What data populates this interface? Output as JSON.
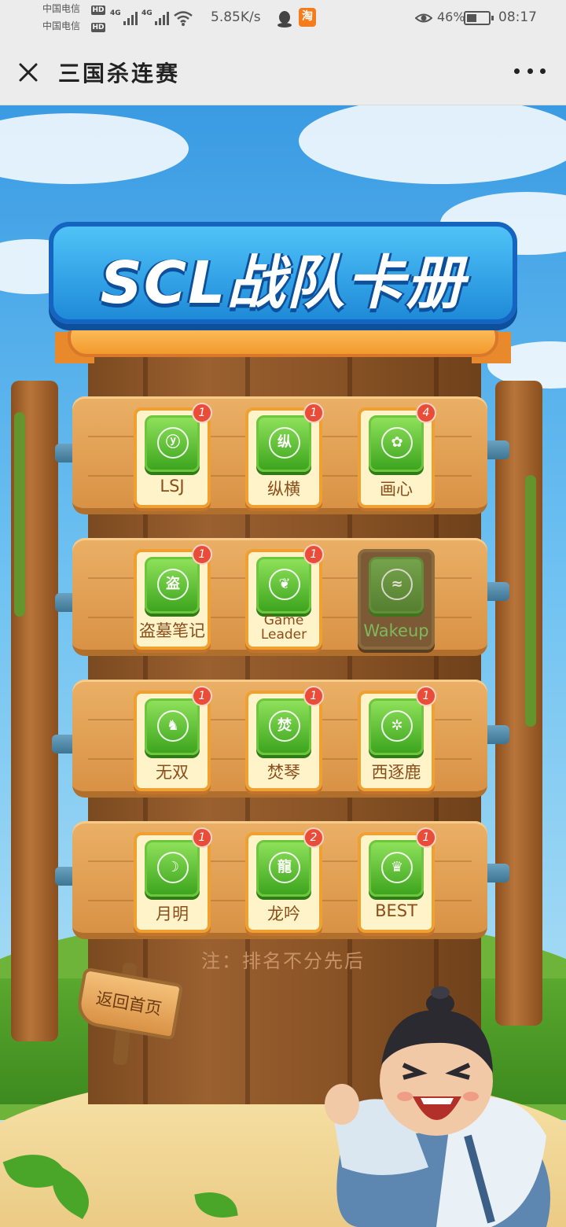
{
  "status_bar": {
    "carrier_1": "中国电信",
    "carrier_2": "中国电信",
    "hd_label": "HD",
    "net_label": "4G",
    "net_speed": "5.85K/s",
    "taobao": "淘",
    "battery_pct": "46%",
    "battery_level": 0.46,
    "time": "08:17"
  },
  "title_bar": {
    "title": "三国杀连赛"
  },
  "banner": {
    "title": "SCL战队卡册"
  },
  "teams": [
    {
      "name": "LSJ",
      "badge": "1",
      "active": true,
      "glyph": "ⓨ"
    },
    {
      "name": "纵横",
      "badge": "1",
      "active": true,
      "glyph": "纵"
    },
    {
      "name": "画心",
      "badge": "4",
      "active": true,
      "glyph": "✿"
    },
    {
      "name": "盗墓笔记",
      "badge": "1",
      "active": true,
      "glyph": "盗"
    },
    {
      "name": "Game Leader",
      "badge": "1",
      "active": true,
      "glyph": "❦"
    },
    {
      "name": "Wakeup",
      "badge": "",
      "active": false,
      "glyph": "≈"
    },
    {
      "name": "无双",
      "badge": "1",
      "active": true,
      "glyph": "♞"
    },
    {
      "name": "焚琴",
      "badge": "1",
      "active": true,
      "glyph": "焚"
    },
    {
      "name": "西逐鹿",
      "badge": "1",
      "active": true,
      "glyph": "✲"
    },
    {
      "name": "月明",
      "badge": "1",
      "active": true,
      "glyph": "☽"
    },
    {
      "name": "龙吟",
      "badge": "2",
      "active": true,
      "glyph": "龍"
    },
    {
      "name": "BEST",
      "badge": "1",
      "active": true,
      "glyph": "♛"
    }
  ],
  "note": "注：排名不分先后",
  "back_button": "返回首页",
  "colors": {
    "sky": "#3a9be3",
    "banner": "#1f8ad8",
    "plank": "#d99245",
    "logo_green": "#3ea51e",
    "badge_red": "#e94d3a"
  }
}
